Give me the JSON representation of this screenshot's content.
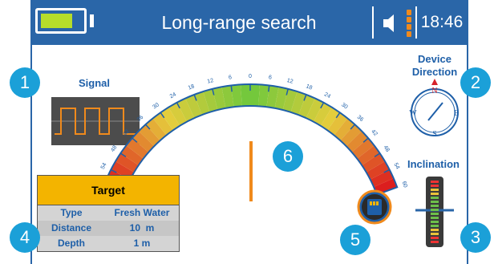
{
  "header": {
    "title": "Long-range search",
    "time": "18:46",
    "battery_level": 0.75,
    "battery_color": "#b6dd2a",
    "sound_icon": "speaker-icon",
    "depth_level_icon": "vertical-level-icon"
  },
  "signal": {
    "label": "Signal"
  },
  "direction": {
    "label_line1": "Device",
    "label_line2": "Direction",
    "compass": {
      "n": "N",
      "e": "E",
      "s": "S",
      "w": "W"
    }
  },
  "inclination": {
    "label": "Inclination"
  },
  "gauge": {
    "ticks": [
      "60",
      "54",
      "48",
      "42",
      "36",
      "30",
      "24",
      "18",
      "12",
      "6",
      "0",
      "6",
      "12",
      "18",
      "24",
      "30",
      "36",
      "42",
      "48",
      "54",
      "60"
    ]
  },
  "target": {
    "header": "Target",
    "rows": [
      {
        "key": "Type",
        "value": "Fresh Water"
      },
      {
        "key": "Distance",
        "value": "10  m"
      },
      {
        "key": "Depth",
        "value": "1 m"
      }
    ]
  },
  "callouts": [
    "1",
    "2",
    "3",
    "4",
    "5",
    "6"
  ],
  "colors": {
    "header_bg": "#2a66a8",
    "accent": "#1ba0d8",
    "target_header": "#f3b400",
    "marker": "#f08a1c"
  }
}
